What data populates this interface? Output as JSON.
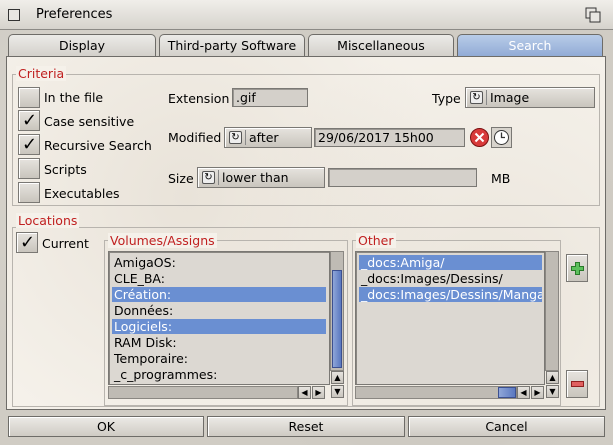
{
  "window": {
    "title": "Preferences"
  },
  "tabs": [
    {
      "label": "Display"
    },
    {
      "label": "Third-party Software"
    },
    {
      "label": "Miscellaneous"
    },
    {
      "label": "Search"
    }
  ],
  "criteria": {
    "group_label": "Criteria",
    "checkboxes": [
      {
        "label": "In the file",
        "checked": false
      },
      {
        "label": "Case sensitive",
        "checked": true
      },
      {
        "label": "Recursive Search",
        "checked": true
      },
      {
        "label": "Scripts",
        "checked": false
      },
      {
        "label": "Executables",
        "checked": false
      }
    ],
    "extension_label": "Extension",
    "extension_value": ".gif",
    "type_label": "Type",
    "type_value": "Image",
    "modified_label": "Modified",
    "modified_mode": "after",
    "modified_date": "29/06/2017 15h00",
    "size_label": "Size",
    "size_mode": "lower than",
    "size_value": "",
    "size_unit": "MB"
  },
  "locations": {
    "group_label": "Locations",
    "current_label": "Current",
    "current_checked": true,
    "volumes_label": "Volumes/Assigns",
    "volumes": [
      {
        "name": "AmigaOS:",
        "selected": false
      },
      {
        "name": "CLE_BA:",
        "selected": false
      },
      {
        "name": "Création:",
        "selected": true
      },
      {
        "name": "Données:",
        "selected": false
      },
      {
        "name": "Logiciels:",
        "selected": true
      },
      {
        "name": "RAM Disk:",
        "selected": false
      },
      {
        "name": "Temporaire:",
        "selected": false
      },
      {
        "name": "_c_programmes:",
        "selected": false
      }
    ],
    "other_label": "Other",
    "other": [
      {
        "name": "_docs:Amiga/",
        "selected": true
      },
      {
        "name": "_docs:Images/Dessins/",
        "selected": false
      },
      {
        "name": "_docs:Images/Dessins/Manga/",
        "selected": true
      }
    ]
  },
  "footer": {
    "ok_label": "OK",
    "reset_label": "Reset",
    "cancel_label": "Cancel"
  },
  "colors": {
    "accent": "#6a8fd2",
    "group_label": "#c02020"
  },
  "icons": {
    "clear": "close-red-icon",
    "calendar": "clock-icon",
    "add": "plus-green-icon",
    "remove": "minus-red-icon"
  }
}
